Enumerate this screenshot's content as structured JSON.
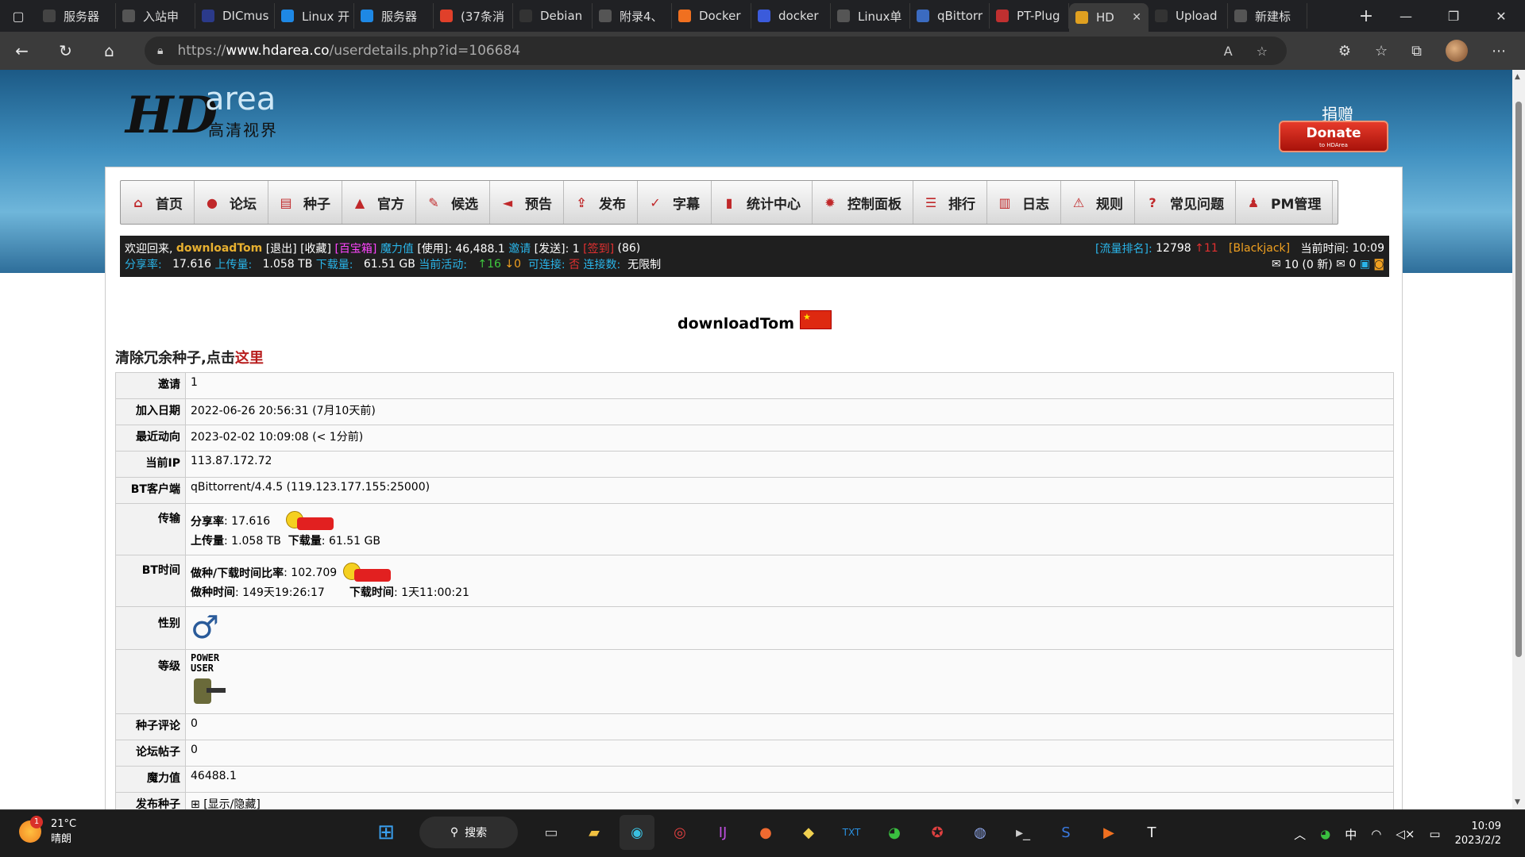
{
  "browser": {
    "tabs": [
      {
        "title": "服务器",
        "icon": "t-b",
        "color": "#444"
      },
      {
        "title": "入站申",
        "icon": "doc",
        "color": "#555"
      },
      {
        "title": "DICmus",
        "icon": "d",
        "color": "#2b3a8a"
      },
      {
        "title": "Linux 开",
        "icon": "l",
        "color": "#1e88e5"
      },
      {
        "title": "服务器",
        "icon": "s",
        "color": "#1e88e5"
      },
      {
        "title": "(37条消",
        "icon": "C",
        "color": "#e0402a"
      },
      {
        "title": "Debian",
        "icon": "gh",
        "color": "#333"
      },
      {
        "title": "附录4、",
        "icon": "pb",
        "color": "#555"
      },
      {
        "title": "Docker",
        "icon": "dk",
        "color": "#f07020"
      },
      {
        "title": "docker",
        "icon": "dt",
        "color": "#3b5bdb"
      },
      {
        "title": "Linux单",
        "icon": "lt",
        "color": "#555"
      },
      {
        "title": "qBittorr",
        "icon": "qb",
        "color": "#3b6bc0"
      },
      {
        "title": "PT-Plug",
        "icon": "pt",
        "color": "#c03030"
      },
      {
        "title": "HD",
        "icon": "hd",
        "color": "#e0a020",
        "active": true
      },
      {
        "title": "Upload",
        "icon": "gh",
        "color": "#333"
      },
      {
        "title": "新建标",
        "icon": "nt",
        "color": "#555"
      }
    ],
    "url_prefix": "https://",
    "url_host": "www.hdarea.co",
    "url_path": "/userdetails.php?id=106684"
  },
  "site": {
    "logo_hd": "HD",
    "logo_area": "area",
    "logo_cn": "高清视界",
    "donate_caption": "捐赠",
    "donate_label": "Donate",
    "donate_sub": "to HDArea"
  },
  "menu": [
    {
      "label": "首页",
      "icon": "home-icon",
      "glyph": "⌂"
    },
    {
      "label": "论坛",
      "icon": "forum-icon",
      "glyph": "●"
    },
    {
      "label": "种子",
      "icon": "torrent-icon",
      "glyph": "▤"
    },
    {
      "label": "官方",
      "icon": "official-icon",
      "glyph": "▲"
    },
    {
      "label": "候选",
      "icon": "candidate-icon",
      "glyph": "✎"
    },
    {
      "label": "预告",
      "icon": "megaphone-icon",
      "glyph": "◄"
    },
    {
      "label": "发布",
      "icon": "upload-icon",
      "glyph": "⇪"
    },
    {
      "label": "字幕",
      "icon": "subtitle-icon",
      "glyph": "✓"
    },
    {
      "label": "统计中心",
      "icon": "stats-icon",
      "glyph": "▮"
    },
    {
      "label": "控制面板",
      "icon": "gear-icon",
      "glyph": "✹"
    },
    {
      "label": "排行",
      "icon": "ranking-icon",
      "glyph": "☰"
    },
    {
      "label": "日志",
      "icon": "log-icon",
      "glyph": "▥"
    },
    {
      "label": "规则",
      "icon": "warning-icon",
      "glyph": "⚠"
    },
    {
      "label": "常见问题",
      "icon": "help-icon",
      "glyph": "?"
    },
    {
      "label": "PM管理",
      "icon": "pm-icon",
      "glyph": "♟"
    }
  ],
  "infobar": {
    "welcome": "欢迎回来,",
    "username": "downloadTom",
    "logout": "[退出]",
    "favorites": "[收藏]",
    "toolbox": "[百宝箱]",
    "magic_label": "魔力值",
    "magic_use": "[使用]: 46,488.1",
    "invite_label": "邀请",
    "invite_send": "[发送]: 1",
    "checkin": "[签到]",
    "checkin_count": "(86)",
    "rank_label": "[流量排名]:",
    "rank_value": "12798",
    "rank_change": "↑11",
    "blackjack": "[Blackjack]",
    "time_label": "当前时间:",
    "time_value": "10:09",
    "ratio_label": "分享率:",
    "ratio_value": "17.616",
    "upload_label": "上传量:",
    "upload_value": "1.058 TB",
    "download_label": "下载量:",
    "download_value": "61.51 GB",
    "active_label": "当前活动:",
    "active_up": "↑16",
    "active_down": "↓0",
    "connectable_label": "可连接:",
    "connectable_value": "否",
    "conn_label": "连接数:",
    "conn_value": "无限制",
    "messages": "10 (0 新)",
    "inbox_count": "0"
  },
  "profile": {
    "username": "downloadTom",
    "flag_glyph": "★",
    "cleanup_text": "清除冗余种子,点击",
    "cleanup_link": "这里",
    "rows": {
      "invite_k": "邀请",
      "invite_v": "1",
      "join_k": "加入日期",
      "join_v": "2022-06-26 20:56:31 (7月10天前)",
      "recent_k": "最近动向",
      "recent_v": "2023-02-02 10:09:08 (< 1分前)",
      "ip_k": "当前IP",
      "ip_v": "113.87.172.72",
      "client_k": "BT客户端",
      "client_v": "qBittorrent/4.4.5 (119.123.177.155:25000)",
      "transfer_k": "传输",
      "ratio_k": "分享率",
      "ratio_v": "17.616",
      "up_k": "上传量",
      "up_v": "1.058 TB",
      "down_k": "下载量",
      "down_v": "61.51 GB",
      "bttime_k": "BT时间",
      "seedratio_k": "做种/下载时间比率",
      "seedratio_v": "102.709",
      "seedtime_k": "做种时间",
      "seedtime_v": "149天19:26:17",
      "dltime_k": "下载时间",
      "dltime_v": "1天11:00:21",
      "gender_k": "性别",
      "gender_glyph": "♂",
      "class_k": "等级",
      "class_v": "POWER USER",
      "comments_k": "种子评论",
      "comments_v": "0",
      "posts_k": "论坛帖子",
      "posts_v": "0",
      "magic_k": "魔力值",
      "magic_v": "46488.1",
      "published_k": "发布种子",
      "published_v": "[显示/隐藏]"
    }
  },
  "taskbar": {
    "temp": "21°C",
    "weather": "晴朗",
    "notif": "1",
    "search": "搜索",
    "ime": "中",
    "time": "10:09",
    "date": "2023/2/2"
  }
}
